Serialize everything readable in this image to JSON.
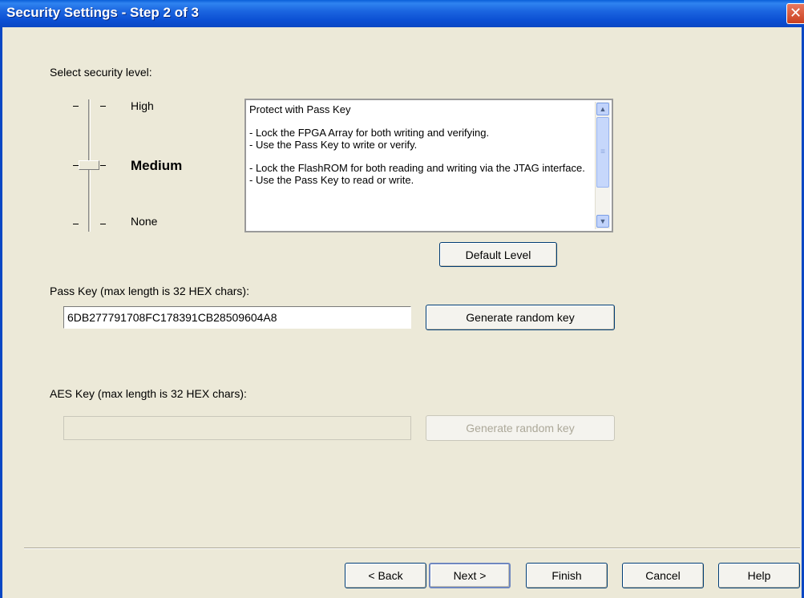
{
  "window": {
    "title": "Security Settings - Step 2 of 3",
    "close_glyph": "✕"
  },
  "security": {
    "select_label": "Select security level:",
    "levels": {
      "high": "High",
      "medium": "Medium",
      "none": "None"
    },
    "selected_level": "Medium"
  },
  "description": {
    "line1": "Protect with Pass Key",
    "line2": "- Lock the FPGA Array for both writing and verifying.",
    "line3": "- Use the Pass Key to write or verify.",
    "line4": "- Lock the FlashROM for both reading and writing via the JTAG interface.",
    "line5": "- Use the Pass Key to read or write."
  },
  "default_level_label": "Default Level",
  "pass_key": {
    "label": "Pass Key (max length is 32 HEX chars):",
    "value": "6DB277791708FC178391CB28509604A8",
    "generate_label": "Generate random key"
  },
  "aes_key": {
    "label": "AES Key (max length is 32 HEX chars):",
    "value": "",
    "generate_label": "Generate random key"
  },
  "footer": {
    "back": "< Back",
    "next": "Next >",
    "finish": "Finish",
    "cancel": "Cancel",
    "help": "Help"
  },
  "icons": {
    "close": "close-icon",
    "scroll_up": "chevron-up-icon",
    "scroll_down": "chevron-down-icon"
  }
}
